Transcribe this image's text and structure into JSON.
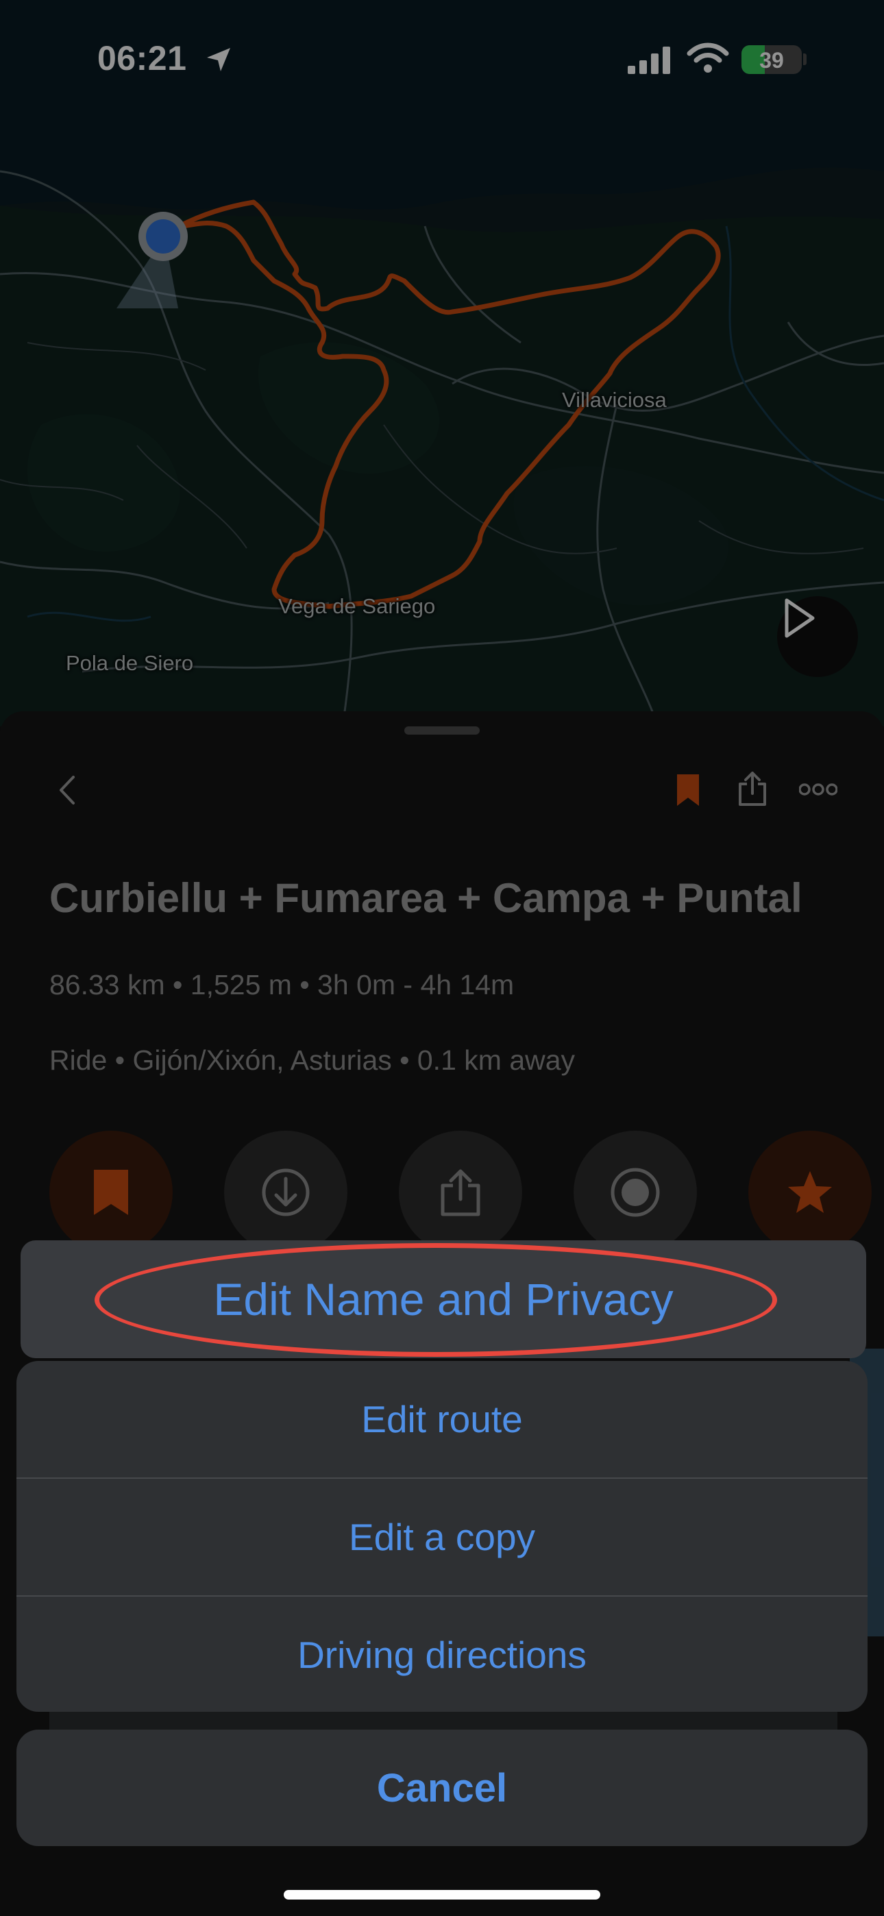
{
  "status_bar": {
    "time": "06:21",
    "battery": "39",
    "battery_level": 0.39
  },
  "map": {
    "places": [
      "Villaviciosa",
      "Vega de Sariego",
      "Pola de Siero"
    ]
  },
  "route": {
    "title": "Curbiellu + Fumarea + Campa + Puntal",
    "stats": "86.33 km • 1,525 m • 3h 0m - 4h 14m",
    "meta": "Ride • Gijón/Xixón, Asturias • 0.1 km away"
  },
  "action_sheet": {
    "highlighted_item": "Edit Name and Privacy",
    "items": [
      "Edit route",
      "Edit a copy",
      "Driving directions"
    ],
    "cancel": "Cancel"
  },
  "colors": {
    "accent_blue": "#4f8fe6",
    "route_orange": "#c44a12",
    "annotation_red": "#e8473d",
    "battery_green": "#34c759"
  },
  "icons": [
    "location-arrow-icon",
    "signal-icon",
    "wifi-icon",
    "battery-icon",
    "play-icon",
    "back-chevron-icon",
    "bookmark-icon",
    "share-icon",
    "more-icon",
    "download-icon",
    "record-icon",
    "star-icon"
  ]
}
